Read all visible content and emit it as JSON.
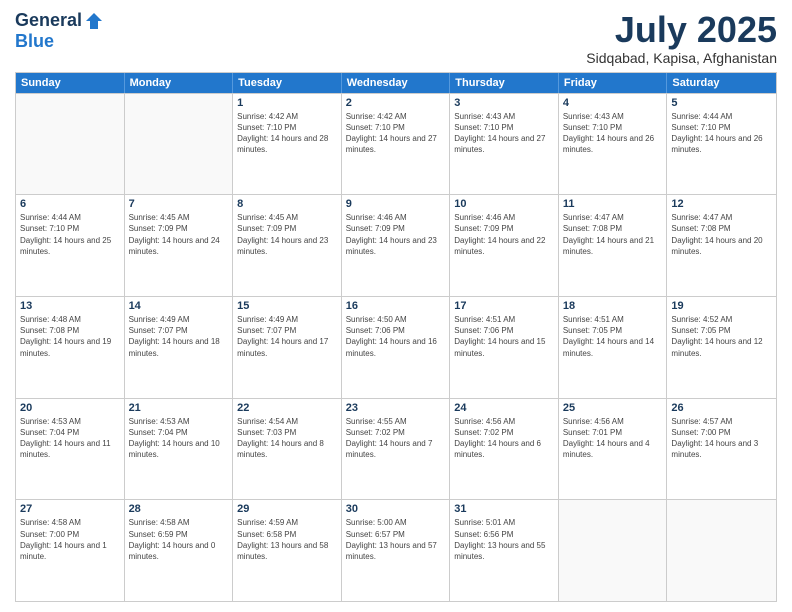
{
  "header": {
    "logo_general": "General",
    "logo_blue": "Blue",
    "main_title": "July 2025",
    "subtitle": "Sidqabad, Kapisa, Afghanistan"
  },
  "calendar": {
    "days_of_week": [
      "Sunday",
      "Monday",
      "Tuesday",
      "Wednesday",
      "Thursday",
      "Friday",
      "Saturday"
    ],
    "weeks": [
      [
        {
          "day": "",
          "info": "",
          "empty": true
        },
        {
          "day": "",
          "info": "",
          "empty": true
        },
        {
          "day": "1",
          "info": "Sunrise: 4:42 AM\nSunset: 7:10 PM\nDaylight: 14 hours and 28 minutes."
        },
        {
          "day": "2",
          "info": "Sunrise: 4:42 AM\nSunset: 7:10 PM\nDaylight: 14 hours and 27 minutes."
        },
        {
          "day": "3",
          "info": "Sunrise: 4:43 AM\nSunset: 7:10 PM\nDaylight: 14 hours and 27 minutes."
        },
        {
          "day": "4",
          "info": "Sunrise: 4:43 AM\nSunset: 7:10 PM\nDaylight: 14 hours and 26 minutes."
        },
        {
          "day": "5",
          "info": "Sunrise: 4:44 AM\nSunset: 7:10 PM\nDaylight: 14 hours and 26 minutes."
        }
      ],
      [
        {
          "day": "6",
          "info": "Sunrise: 4:44 AM\nSunset: 7:10 PM\nDaylight: 14 hours and 25 minutes."
        },
        {
          "day": "7",
          "info": "Sunrise: 4:45 AM\nSunset: 7:09 PM\nDaylight: 14 hours and 24 minutes."
        },
        {
          "day": "8",
          "info": "Sunrise: 4:45 AM\nSunset: 7:09 PM\nDaylight: 14 hours and 23 minutes."
        },
        {
          "day": "9",
          "info": "Sunrise: 4:46 AM\nSunset: 7:09 PM\nDaylight: 14 hours and 23 minutes."
        },
        {
          "day": "10",
          "info": "Sunrise: 4:46 AM\nSunset: 7:09 PM\nDaylight: 14 hours and 22 minutes."
        },
        {
          "day": "11",
          "info": "Sunrise: 4:47 AM\nSunset: 7:08 PM\nDaylight: 14 hours and 21 minutes."
        },
        {
          "day": "12",
          "info": "Sunrise: 4:47 AM\nSunset: 7:08 PM\nDaylight: 14 hours and 20 minutes."
        }
      ],
      [
        {
          "day": "13",
          "info": "Sunrise: 4:48 AM\nSunset: 7:08 PM\nDaylight: 14 hours and 19 minutes."
        },
        {
          "day": "14",
          "info": "Sunrise: 4:49 AM\nSunset: 7:07 PM\nDaylight: 14 hours and 18 minutes."
        },
        {
          "day": "15",
          "info": "Sunrise: 4:49 AM\nSunset: 7:07 PM\nDaylight: 14 hours and 17 minutes."
        },
        {
          "day": "16",
          "info": "Sunrise: 4:50 AM\nSunset: 7:06 PM\nDaylight: 14 hours and 16 minutes."
        },
        {
          "day": "17",
          "info": "Sunrise: 4:51 AM\nSunset: 7:06 PM\nDaylight: 14 hours and 15 minutes."
        },
        {
          "day": "18",
          "info": "Sunrise: 4:51 AM\nSunset: 7:05 PM\nDaylight: 14 hours and 14 minutes."
        },
        {
          "day": "19",
          "info": "Sunrise: 4:52 AM\nSunset: 7:05 PM\nDaylight: 14 hours and 12 minutes."
        }
      ],
      [
        {
          "day": "20",
          "info": "Sunrise: 4:53 AM\nSunset: 7:04 PM\nDaylight: 14 hours and 11 minutes."
        },
        {
          "day": "21",
          "info": "Sunrise: 4:53 AM\nSunset: 7:04 PM\nDaylight: 14 hours and 10 minutes."
        },
        {
          "day": "22",
          "info": "Sunrise: 4:54 AM\nSunset: 7:03 PM\nDaylight: 14 hours and 8 minutes."
        },
        {
          "day": "23",
          "info": "Sunrise: 4:55 AM\nSunset: 7:02 PM\nDaylight: 14 hours and 7 minutes."
        },
        {
          "day": "24",
          "info": "Sunrise: 4:56 AM\nSunset: 7:02 PM\nDaylight: 14 hours and 6 minutes."
        },
        {
          "day": "25",
          "info": "Sunrise: 4:56 AM\nSunset: 7:01 PM\nDaylight: 14 hours and 4 minutes."
        },
        {
          "day": "26",
          "info": "Sunrise: 4:57 AM\nSunset: 7:00 PM\nDaylight: 14 hours and 3 minutes."
        }
      ],
      [
        {
          "day": "27",
          "info": "Sunrise: 4:58 AM\nSunset: 7:00 PM\nDaylight: 14 hours and 1 minute."
        },
        {
          "day": "28",
          "info": "Sunrise: 4:58 AM\nSunset: 6:59 PM\nDaylight: 14 hours and 0 minutes."
        },
        {
          "day": "29",
          "info": "Sunrise: 4:59 AM\nSunset: 6:58 PM\nDaylight: 13 hours and 58 minutes."
        },
        {
          "day": "30",
          "info": "Sunrise: 5:00 AM\nSunset: 6:57 PM\nDaylight: 13 hours and 57 minutes."
        },
        {
          "day": "31",
          "info": "Sunrise: 5:01 AM\nSunset: 6:56 PM\nDaylight: 13 hours and 55 minutes."
        },
        {
          "day": "",
          "info": "",
          "empty": true
        },
        {
          "day": "",
          "info": "",
          "empty": true
        }
      ]
    ]
  }
}
